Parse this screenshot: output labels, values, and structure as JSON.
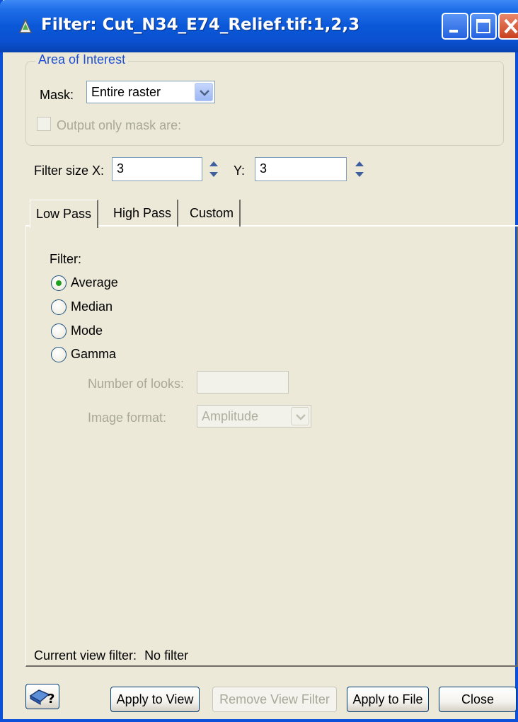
{
  "window": {
    "title": "Filter: Cut_N34_E74_Relief.tif:1,2,3"
  },
  "area_of_interest": {
    "legend": "Area of Interest",
    "mask_label": "Mask:",
    "mask_value": "Entire raster",
    "output_only_label": "Output only mask are:",
    "output_only_checked": false
  },
  "filter_size": {
    "x_label": "Filter size X:",
    "x_value": "3",
    "y_label": "Y:",
    "y_value": "3"
  },
  "tabs": [
    {
      "label": "Low Pass",
      "active": true
    },
    {
      "label": "High Pass",
      "active": false
    },
    {
      "label": "Custom",
      "active": false
    }
  ],
  "low_pass": {
    "filter_label": "Filter:",
    "options": [
      {
        "label": "Average",
        "selected": true
      },
      {
        "label": "Median",
        "selected": false
      },
      {
        "label": "Mode",
        "selected": false
      },
      {
        "label": "Gamma",
        "selected": false
      }
    ],
    "looks_label": "Number of looks:",
    "looks_value": "",
    "image_format_label": "Image format:",
    "image_format_value": "Amplitude"
  },
  "status": {
    "label": "Current view filter:",
    "value": "No filter"
  },
  "buttons": {
    "apply_view": "Apply to View",
    "remove_view": "Remove View Filter",
    "apply_file": "Apply to File",
    "close": "Close"
  },
  "icons": {
    "title": "filter-app-icon",
    "help": "help-book-icon"
  }
}
